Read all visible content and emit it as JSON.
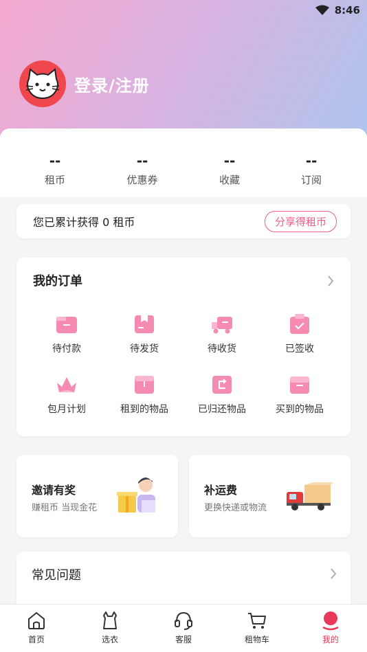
{
  "status_bar": {
    "time": "8:46"
  },
  "profile": {
    "login_label": "登录/注册"
  },
  "stats": [
    {
      "value": "--",
      "label": "租币"
    },
    {
      "value": "--",
      "label": "优惠券"
    },
    {
      "value": "--",
      "label": "收藏"
    },
    {
      "value": "--",
      "label": "订阅"
    }
  ],
  "coin_card": {
    "text": "您已累计获得 0 租币",
    "button": "分享得租币"
  },
  "orders": {
    "title": "我的订单",
    "items": [
      {
        "label": "待付款",
        "icon": "wallet-icon"
      },
      {
        "label": "待发货",
        "icon": "box-icon"
      },
      {
        "label": "待收货",
        "icon": "truck-icon"
      },
      {
        "label": "已签收",
        "icon": "signed-icon"
      },
      {
        "label": "包月计划",
        "icon": "crown-icon"
      },
      {
        "label": "租到的物品",
        "icon": "rent-box-icon"
      },
      {
        "label": "已归还物品",
        "icon": "return-icon"
      },
      {
        "label": "买到的物品",
        "icon": "bought-icon"
      }
    ]
  },
  "promos": [
    {
      "title": "邀请有奖",
      "subtitle": "赚租币 当现金花",
      "icon": "gift-person-icon"
    },
    {
      "title": "补运费",
      "subtitle": "更换快递或物流",
      "icon": "delivery-truck-icon"
    }
  ],
  "faq": {
    "title": "常见问题"
  },
  "tabbar": {
    "items": [
      {
        "label": "首页",
        "icon": "home-icon"
      },
      {
        "label": "选衣",
        "icon": "clothes-icon"
      },
      {
        "label": "客服",
        "icon": "headset-icon"
      },
      {
        "label": "租物车",
        "icon": "cart-icon"
      },
      {
        "label": "我的",
        "icon": "profile-icon"
      }
    ],
    "active_index": 4
  },
  "colors": {
    "accent": "#ee5c82",
    "icon_pink": "#f58bb0",
    "active": "#e8395a",
    "avatar_bg": "#f0474f"
  }
}
